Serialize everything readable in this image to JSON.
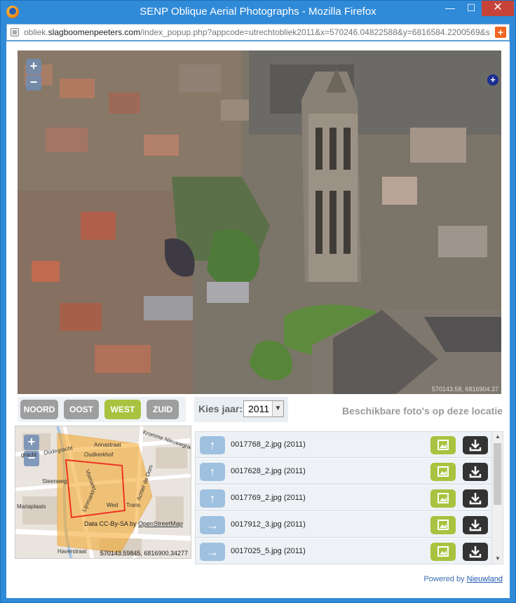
{
  "window": {
    "title": "SENP Oblique Aerial Photographs - Mozilla Firefox",
    "minimize": "—",
    "maximize": "☐",
    "close": "✕"
  },
  "urlbar": {
    "prefix": "obliek.",
    "domain": "slagboomenpeeters.com",
    "path": "/index_popup.php?appcode=utrechtobliek2011&x=570246.04822588&y=6816584.2200569&s"
  },
  "photo": {
    "attribution": "570143.58, 6816904.37",
    "zoom_in": "+",
    "zoom_out": "−",
    "expand": "+"
  },
  "directions": [
    "NOORD",
    "OOST",
    "WEST",
    "ZUID"
  ],
  "active_direction": "WEST",
  "year": {
    "label": "Kies jaar:",
    "selected": "2011"
  },
  "available_label": "Beschikbare foto's op deze locatie",
  "minimap": {
    "zoom_in": "+",
    "zoom_out": "−",
    "streets": [
      "Annastraat",
      "Oudkerkhof",
      "Kromme Nieuwegracht",
      "Steenweg",
      "Vismarkt",
      "Lijnmarkt",
      "Achter de Dom",
      "Trans",
      "Wed",
      "Mariaplaats",
      "Haverstraat",
      "gracht",
      "Oudegracht"
    ],
    "attribution_prefix": "Data CC-By-SA by",
    "attribution_link": "OpenStreetMap",
    "coordinates": "570143.59845, 6816900.34277"
  },
  "photos": [
    {
      "name": "0017768_2.jpg (2011)",
      "arrow": "↑"
    },
    {
      "name": "0017628_2.jpg (2011)",
      "arrow": "↑"
    },
    {
      "name": "0017769_2.jpg (2011)",
      "arrow": "↑"
    },
    {
      "name": "0017912_3.jpg (2011)",
      "arrow": "→"
    },
    {
      "name": "0017025_5.jpg (2011)",
      "arrow": "→"
    }
  ],
  "powered": {
    "prefix": "Powered by",
    "link": "Nieuwland"
  },
  "icons": {
    "view": "image-icon",
    "download": "download-icon"
  }
}
